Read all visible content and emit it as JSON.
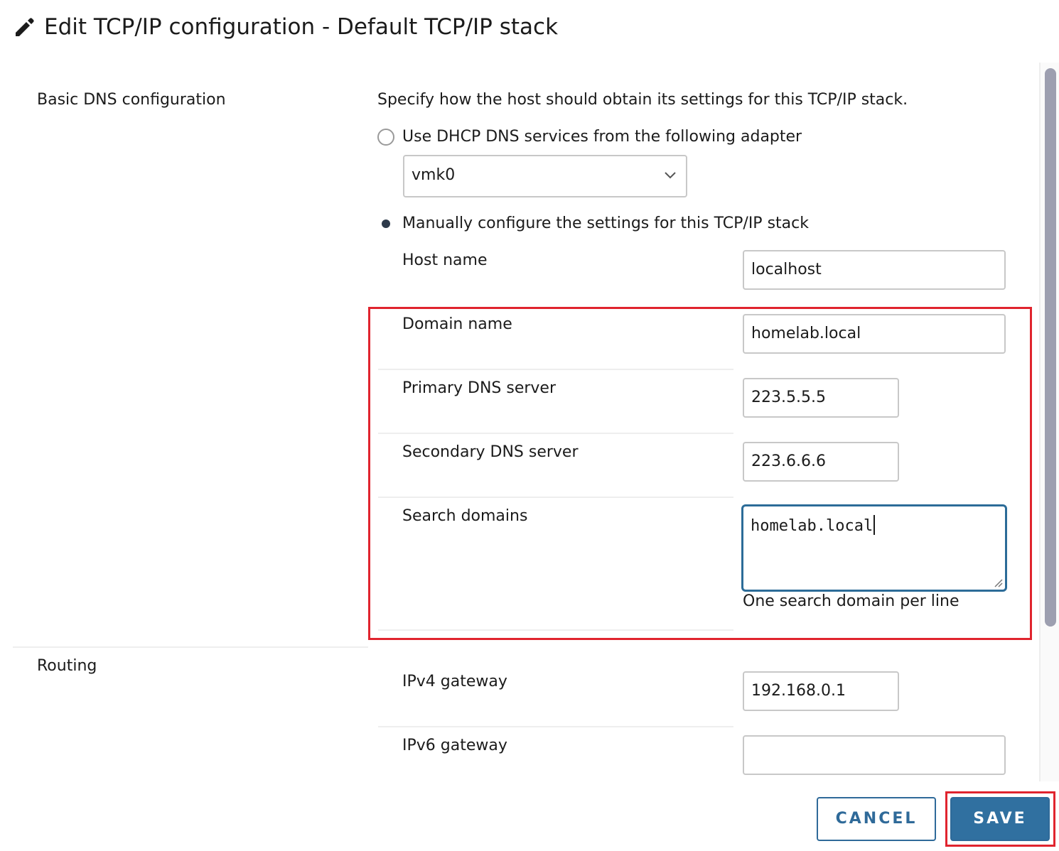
{
  "dialog": {
    "title": "Edit TCP/IP configuration - Default TCP/IP stack",
    "icon": "pencil-icon"
  },
  "dns": {
    "section_label": "Basic DNS configuration",
    "description": "Specify how the host should obtain its settings for this TCP/IP stack.",
    "dhcp_option_label": "Use DHCP DNS services from the following adapter",
    "dhcp_selected": false,
    "adapter_value": "vmk0",
    "manual_option_label": "Manually configure the settings for this TCP/IP stack",
    "manual_selected": true,
    "host_name_label": "Host name",
    "host_name_value": "localhost",
    "domain_name_label": "Domain name",
    "domain_name_value": "homelab.local",
    "primary_dns_label": "Primary DNS server",
    "primary_dns_value": "223.5.5.5",
    "secondary_dns_label": "Secondary DNS server",
    "secondary_dns_value": "223.6.6.6",
    "search_domains_label": "Search domains",
    "search_domains_value": "homelab.local",
    "search_domains_hint": "One search domain per line"
  },
  "routing": {
    "section_label": "Routing",
    "ipv4_gateway_label": "IPv4 gateway",
    "ipv4_gateway_value": "192.168.0.1",
    "ipv6_gateway_label": "IPv6 gateway",
    "ipv6_gateway_value": ""
  },
  "footer": {
    "cancel_label": "CANCEL",
    "save_label": "SAVE"
  },
  "colors": {
    "accent": "#3070a0",
    "highlight": "#e0242e",
    "focus_border": "#2c6c98"
  }
}
